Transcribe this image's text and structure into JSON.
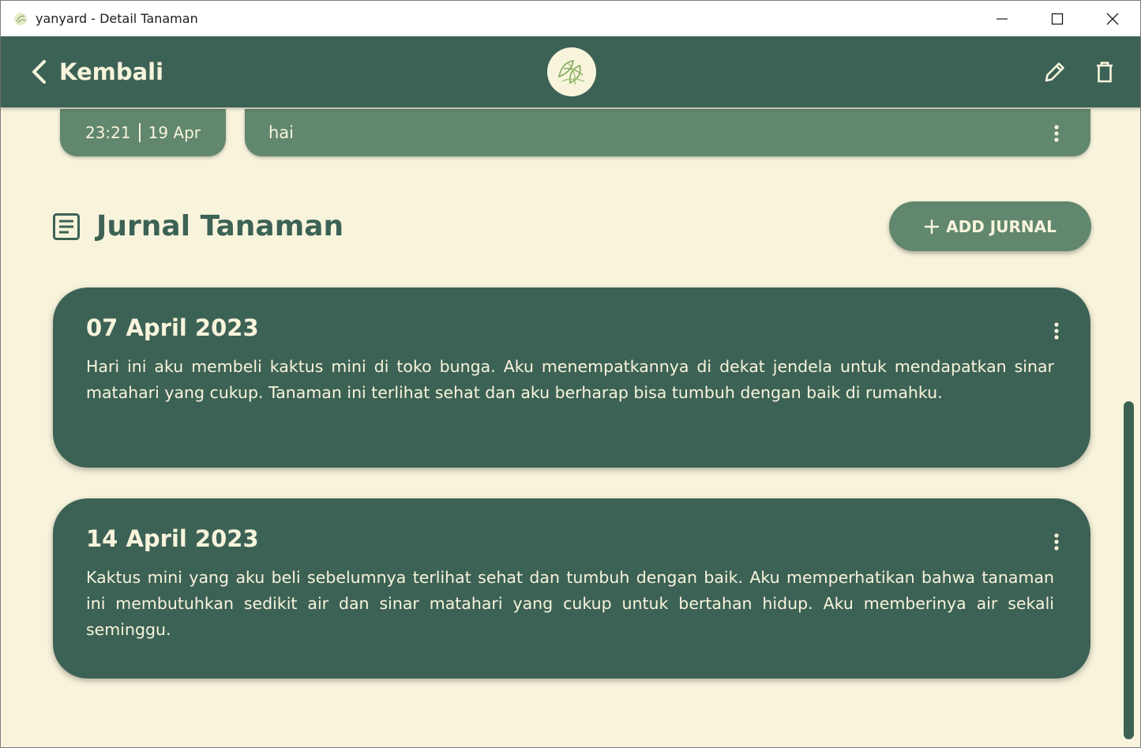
{
  "window": {
    "title": "yanyard - Detail Tanaman"
  },
  "appbar": {
    "back_label": "Kembali",
    "icons": [
      "chevron-left-icon",
      "plant-logo",
      "edit-pencil-icon",
      "trash-icon"
    ]
  },
  "note": {
    "time": "23:21",
    "date": "19 Apr",
    "text": "hai"
  },
  "journal": {
    "title": "Jurnal Tanaman",
    "add_label": "ADD JURNAL",
    "entries": [
      {
        "date": "07 April 2023",
        "body": "Hari ini aku membeli kaktus mini di toko bunga. Aku menempatkannya di dekat jendela untuk mendapatkan sinar matahari yang cukup. Tanaman ini terlihat sehat dan aku berharap bisa tumbuh dengan baik di rumahku."
      },
      {
        "date": "14 April 2023",
        "body": "Kaktus mini yang aku beli sebelumnya terlihat sehat dan tumbuh dengan baik. Aku memperhatikan bahwa tanaman ini membutuhkan sedikit air dan sinar matahari yang cukup untuk bertahan hidup. Aku memberinya air sekali seminggu."
      }
    ]
  },
  "colors": {
    "primary": "#3c6255",
    "secondary": "#61876e",
    "background": "#f8f4dc"
  }
}
